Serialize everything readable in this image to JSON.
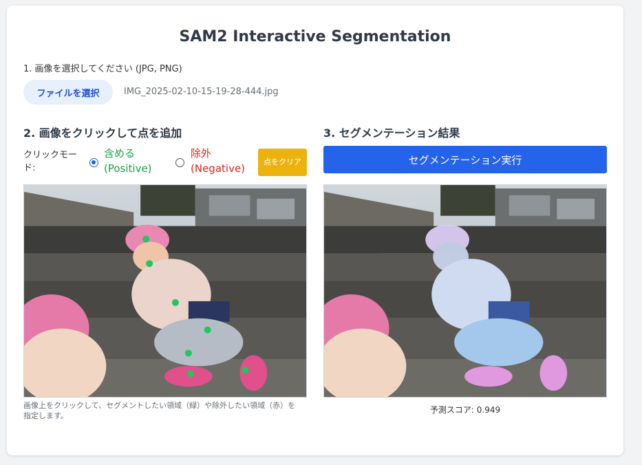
{
  "title": "SAM2 Interactive Segmentation",
  "step1": {
    "label": "1. 画像を選択してください (JPG, PNG)",
    "file_button": "ファイルを選択",
    "file_name": "IMG_2025-02-10-15-19-28-444.jpg"
  },
  "step2": {
    "heading": "2. 画像をクリックして点を追加",
    "mode_label": "クリックモード:",
    "positive_label": "含める (Positive)",
    "negative_label": "除外 (Negative)",
    "selected_mode": "positive",
    "clear_button": "点をクリア",
    "hint": "画像上をクリックして、セグメントしたい領域（緑）や除外したい領域（赤）を指定します。",
    "points": [
      {
        "type": "positive"
      },
      {
        "type": "positive"
      },
      {
        "type": "positive"
      },
      {
        "type": "positive"
      },
      {
        "type": "positive"
      },
      {
        "type": "positive"
      },
      {
        "type": "positive"
      }
    ]
  },
  "step3": {
    "heading": "3. セグメンテーション結果",
    "run_button": "セグメンテーション実行",
    "score_text": "予測スコア: 0.949"
  },
  "colors": {
    "accent": "#2563eb",
    "positive": "#1aa14a",
    "negative": "#d8261e",
    "clear_button": "#ecb30f",
    "point_positive": "#22c55e"
  }
}
